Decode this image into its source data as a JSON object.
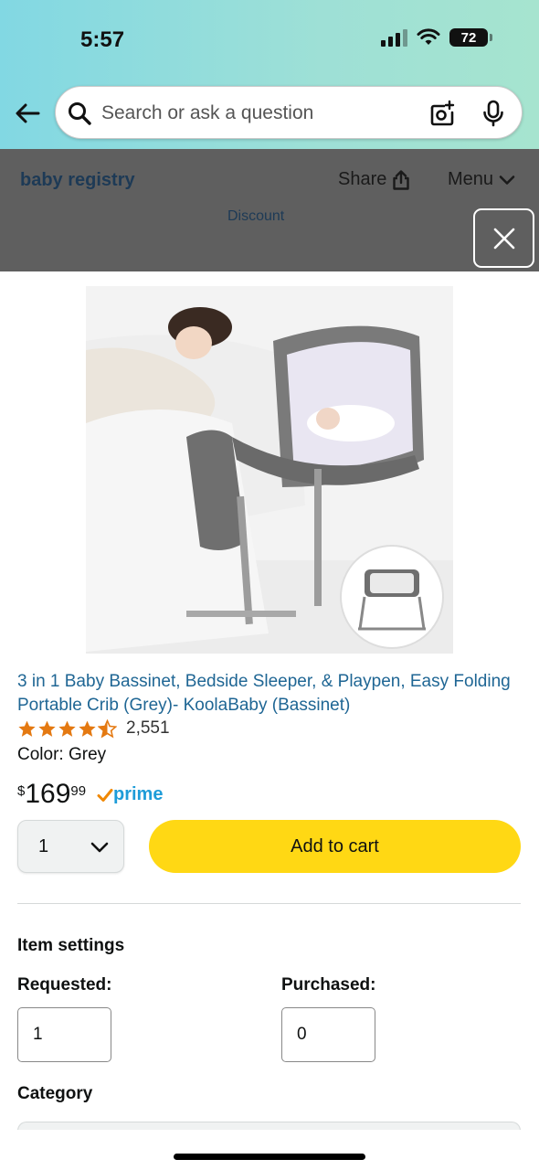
{
  "status_bar": {
    "time": "5:57",
    "battery": "72"
  },
  "search": {
    "placeholder": "Search or ask a question"
  },
  "registry_bar": {
    "title": "baby registry",
    "share_label": "Share",
    "menu_label": "Menu",
    "discount_label": "Discount"
  },
  "product": {
    "title": "3 in 1 Baby Bassinet, Bedside Sleeper, & Playpen, Easy Folding Portable Crib (Grey)- KoolaBaby (Bassinet)",
    "rating_count": "2,551",
    "rating_stars": 4.5,
    "color": "Color: Grey",
    "price_symbol": "$",
    "price_whole": "169",
    "price_fraction": "99",
    "prime_label": "prime",
    "quantity": "1",
    "add_to_cart_label": "Add to cart"
  },
  "item_settings": {
    "heading": "Item settings",
    "requested_label": "Requested:",
    "requested_value": "1",
    "purchased_label": "Purchased:",
    "purchased_value": "0",
    "category_label": "Category"
  },
  "colors": {
    "button_yellow": "#ffd814",
    "link_blue": "#1f6694",
    "star_orange": "#e47911",
    "prime_blue": "#1e9cd8"
  },
  "icons": [
    "back-arrow-icon",
    "search-icon",
    "camera-icon",
    "microphone-icon",
    "share-icon",
    "chevron-down-icon",
    "close-icon",
    "star-icon",
    "prime-check-icon"
  ]
}
